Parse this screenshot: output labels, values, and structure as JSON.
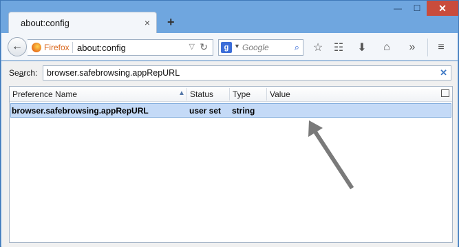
{
  "tab": {
    "title": "about:config",
    "close_glyph": "×"
  },
  "newtab_glyph": "+",
  "window_controls": {
    "minimize": "—",
    "maximize": "☐",
    "close": "✕"
  },
  "navbar": {
    "identity_label": "Firefox",
    "url": "about:config",
    "search_placeholder": "Google",
    "search_engine_glyph": "g"
  },
  "config": {
    "search_label_prefix": "Se",
    "search_label_underlined": "a",
    "search_label_suffix": "rch:",
    "filter_value": "browser.safebrowsing.appRepURL",
    "columns": [
      "Preference Name",
      "Status",
      "Type",
      "Value"
    ],
    "rows": [
      {
        "name": "browser.safebrowsing.appRepURL",
        "status": "user set",
        "type": "string",
        "value": ""
      }
    ]
  },
  "colors": {
    "selection": "#c4daf7",
    "annotation_arrow": "#7a7a7a",
    "window_frame": "#6fa6df"
  }
}
